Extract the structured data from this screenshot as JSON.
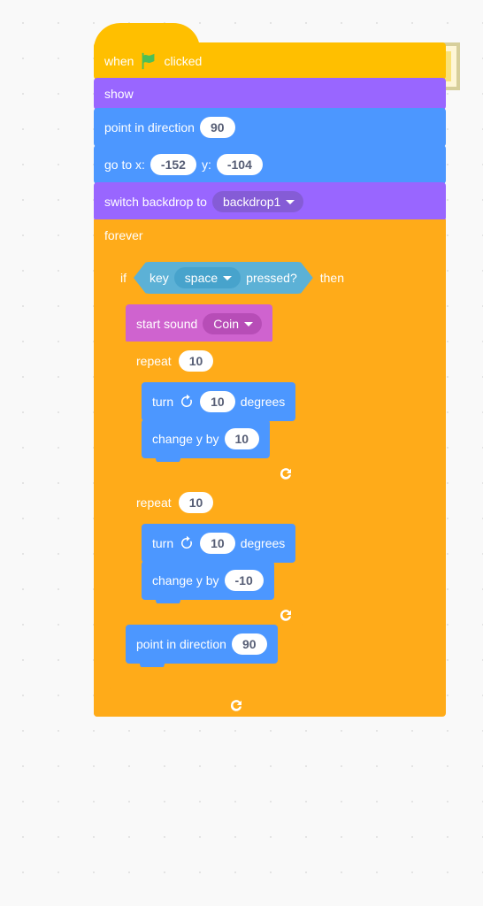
{
  "hat": {
    "prefix": "when",
    "suffix": "clicked"
  },
  "show": {
    "label": "show"
  },
  "point_dir": {
    "label_a": "point in direction",
    "value": "90"
  },
  "goto": {
    "label_a": "go to x:",
    "x": "-152",
    "label_b": "y:",
    "y": "-104"
  },
  "switch_bd": {
    "label": "switch backdrop to",
    "option": "backdrop1"
  },
  "forever": {
    "label": "forever"
  },
  "if": {
    "label_a": "if",
    "label_b": "then"
  },
  "key_pressed": {
    "label_a": "key",
    "option": "space",
    "label_b": "pressed?"
  },
  "start_sound": {
    "label": "start sound",
    "option": "Coin"
  },
  "repeat1": {
    "label": "repeat",
    "count": "10"
  },
  "turn1": {
    "label_a": "turn",
    "value": "10",
    "label_b": "degrees"
  },
  "chy1": {
    "label": "change y by",
    "value": "10"
  },
  "repeat2": {
    "label": "repeat",
    "count": "10"
  },
  "turn2": {
    "label_a": "turn",
    "value": "10",
    "label_b": "degrees"
  },
  "chy2": {
    "label": "change y by",
    "value": "-10"
  },
  "point_dir2": {
    "label_a": "point in direction",
    "value": "90"
  },
  "colors": {
    "events": "#ffbf00",
    "looks": "#9966ff",
    "motion": "#4c97ff",
    "control": "#ffab19",
    "sound": "#cf63cf",
    "sensing": "#5cb1d6"
  }
}
